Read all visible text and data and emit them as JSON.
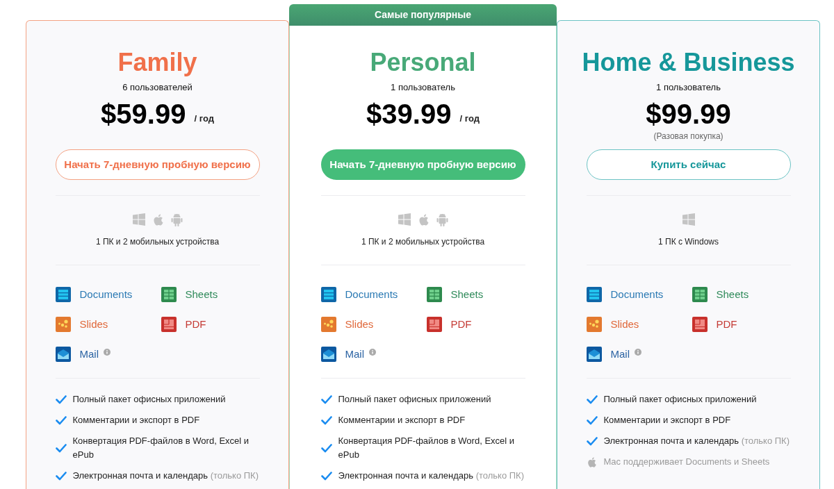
{
  "plans": [
    {
      "name": "Family",
      "color": "#f0704a",
      "featured": false,
      "users": "6 пользователей",
      "price": "$59.99",
      "period": "/ год",
      "button": {
        "label": "Начать 7-дневную пробную версию",
        "kind": "outline"
      },
      "platforms": [
        {
          "kind": "windows"
        },
        {
          "kind": "apple"
        },
        {
          "kind": "android"
        }
      ],
      "devices": "1 ПК и 2 мобильных устройства",
      "apps": [
        {
          "kind": "documents",
          "label": "Documents",
          "info": false
        },
        {
          "kind": "sheets",
          "label": "Sheets",
          "info": false
        },
        {
          "kind": "slides",
          "label": "Slides",
          "info": false
        },
        {
          "kind": "pdf",
          "label": "PDF",
          "info": false
        },
        {
          "kind": "mail",
          "label": "Mail",
          "info": true
        }
      ],
      "features": [
        {
          "kind": "check",
          "text": "Полный пакет офисных приложений"
        },
        {
          "kind": "check",
          "text": "Комментарии и экспорт в PDF"
        },
        {
          "kind": "check",
          "text": "Конвертация PDF-файлов в Word, Excel и ePub"
        },
        {
          "kind": "check",
          "text": "Электронная почта и календарь",
          "note": "(только ПК)"
        }
      ]
    },
    {
      "name": "Personal",
      "color": "#48a978",
      "featured": true,
      "badge": "Самые популярные",
      "users": "1 пользователь",
      "price": "$39.99",
      "period": "/ год",
      "button": {
        "label": "Начать 7-дневную пробную версию",
        "kind": "filled"
      },
      "platforms": [
        {
          "kind": "windows"
        },
        {
          "kind": "apple"
        },
        {
          "kind": "android"
        }
      ],
      "devices": "1 ПК и 2 мобильных устройства",
      "apps": [
        {
          "kind": "documents",
          "label": "Documents",
          "info": false
        },
        {
          "kind": "sheets",
          "label": "Sheets",
          "info": false
        },
        {
          "kind": "slides",
          "label": "Slides",
          "info": false
        },
        {
          "kind": "pdf",
          "label": "PDF",
          "info": false
        },
        {
          "kind": "mail",
          "label": "Mail",
          "info": true
        }
      ],
      "features": [
        {
          "kind": "check",
          "text": "Полный пакет офисных приложений"
        },
        {
          "kind": "check",
          "text": "Комментарии и экспорт в PDF"
        },
        {
          "kind": "check",
          "text": "Конвертация PDF-файлов в Word, Excel и ePub"
        },
        {
          "kind": "check",
          "text": "Электронная почта и календарь",
          "note": "(только ПК)"
        }
      ]
    },
    {
      "name": "Home & Business",
      "color": "#16979a",
      "featured": false,
      "users": "1 пользователь",
      "price": "$99.99",
      "price_note": "(Разовая покупка)",
      "button": {
        "label": "Купить сейчас",
        "kind": "outline"
      },
      "platforms": [
        {
          "kind": "windows"
        }
      ],
      "devices": "1 ПК с Windows",
      "apps": [
        {
          "kind": "documents",
          "label": "Documents",
          "info": false
        },
        {
          "kind": "sheets",
          "label": "Sheets",
          "info": false
        },
        {
          "kind": "slides",
          "label": "Slides",
          "info": false
        },
        {
          "kind": "pdf",
          "label": "PDF",
          "info": false
        },
        {
          "kind": "mail",
          "label": "Mail",
          "info": true
        }
      ],
      "features": [
        {
          "kind": "check",
          "text": "Полный пакет офисных приложений"
        },
        {
          "kind": "check",
          "text": "Комментарии и экспорт в PDF"
        },
        {
          "kind": "check",
          "text": "Электронная почта и календарь",
          "note": "(только ПК)"
        },
        {
          "kind": "apple",
          "text": "Mac поддерживает Documents и Sheets"
        }
      ]
    }
  ]
}
